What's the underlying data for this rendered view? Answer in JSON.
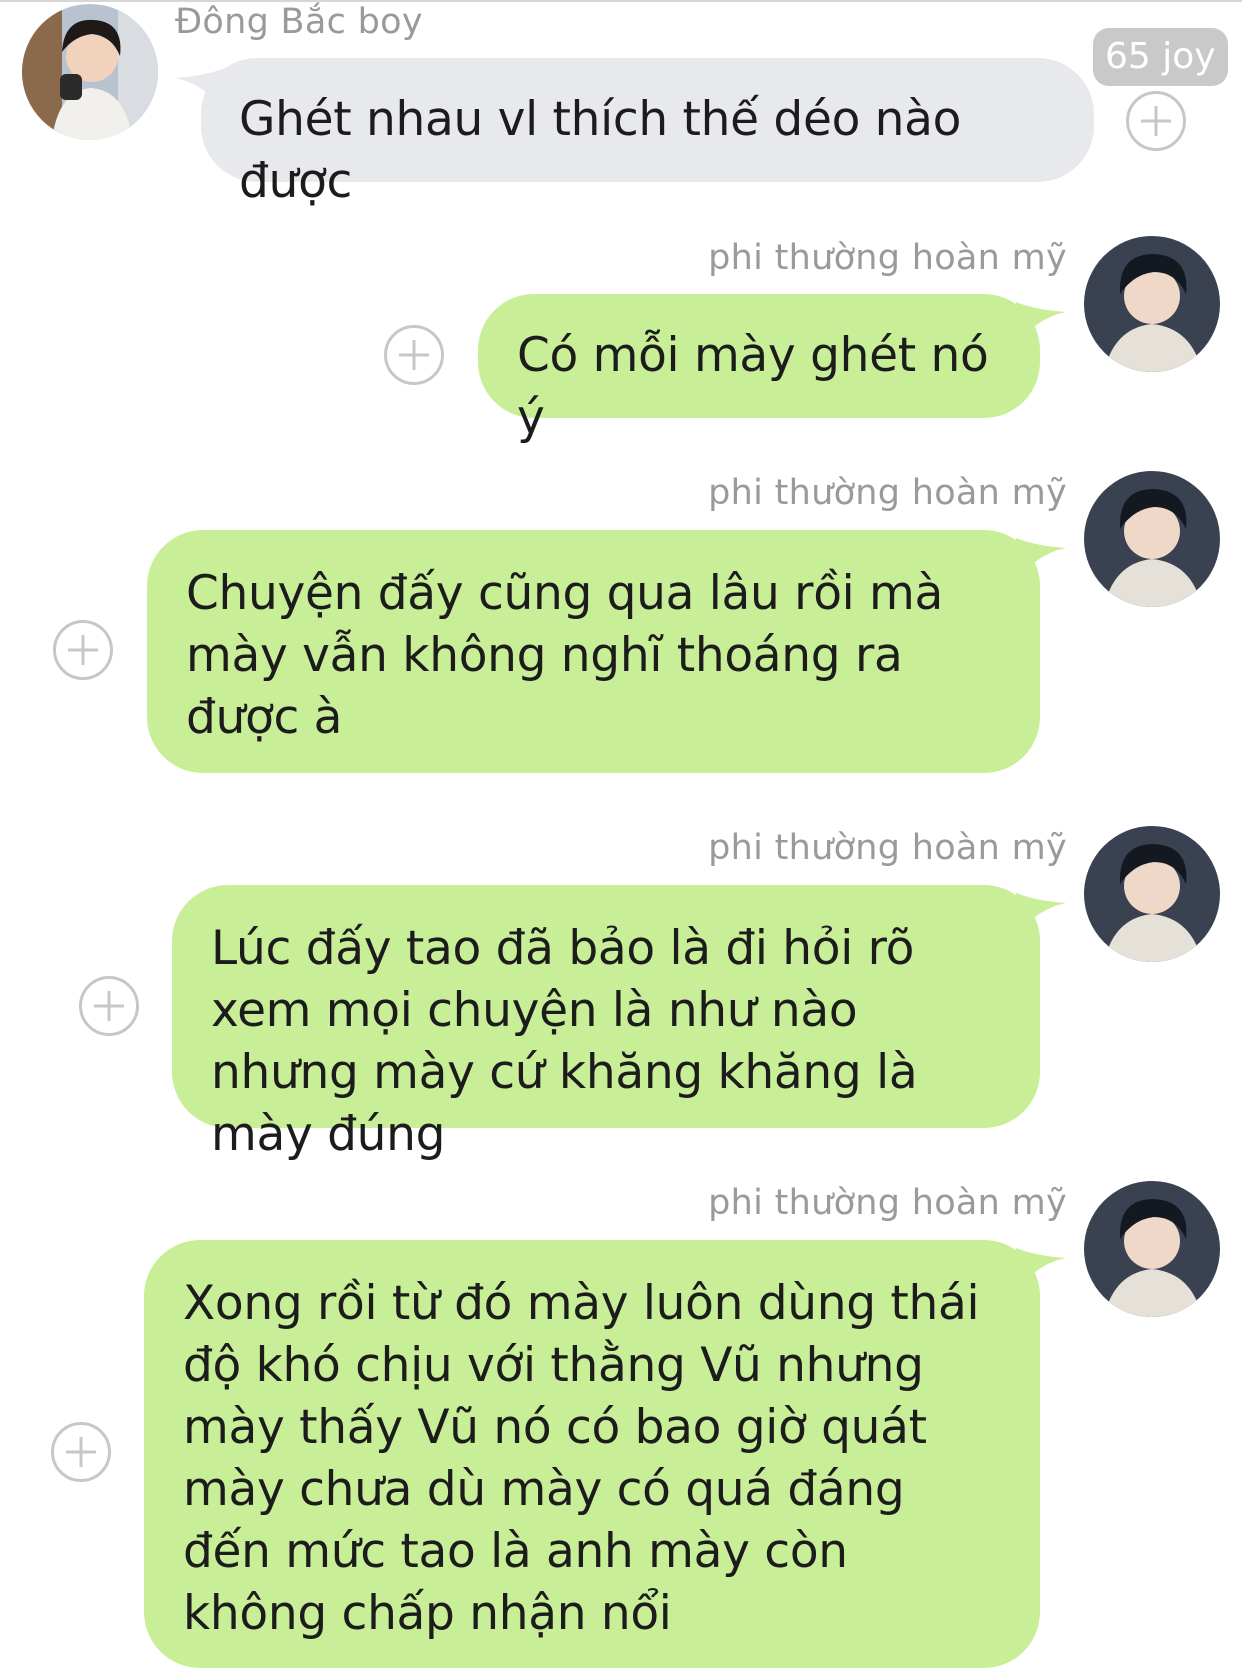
{
  "messages": [
    {
      "sender": "Đông Bắc boy",
      "side": "left",
      "text": "Ghét nhau vl thích thế déo nào được",
      "reaction_badge": "65 joy"
    },
    {
      "sender": "phi thường hoàn mỹ",
      "side": "right",
      "text": "Có mỗi mày ghét nó ý"
    },
    {
      "sender": "phi thường hoàn mỹ",
      "side": "right",
      "text": "Chuyện đấy cũng qua lâu rồi mà mày vẫn không nghĩ thoáng ra được à"
    },
    {
      "sender": "phi thường hoàn mỹ",
      "side": "right",
      "text": "Lúc đấy tao đã bảo là đi hỏi rõ xem mọi chuyện là như nào nhưng mày cứ khăng khăng là mày đúng"
    },
    {
      "sender": "phi thường hoàn mỹ",
      "side": "right",
      "text": "Xong rồi từ đó mày luôn dùng thái độ khó chịu với thằng Vũ nhưng mày thấy Vũ nó có bao giờ quát mày chưa dù mày có quá đáng đến mức tao là anh mày còn không chấp nhận nổi"
    }
  ],
  "colors": {
    "incoming_bubble": "#e8e9ec",
    "outgoing_bubble": "#c9ee98",
    "name_text": "#9a9a9a",
    "badge": "#c9c9c9"
  },
  "icons": {
    "reaction_button": "plus-circle-icon"
  }
}
